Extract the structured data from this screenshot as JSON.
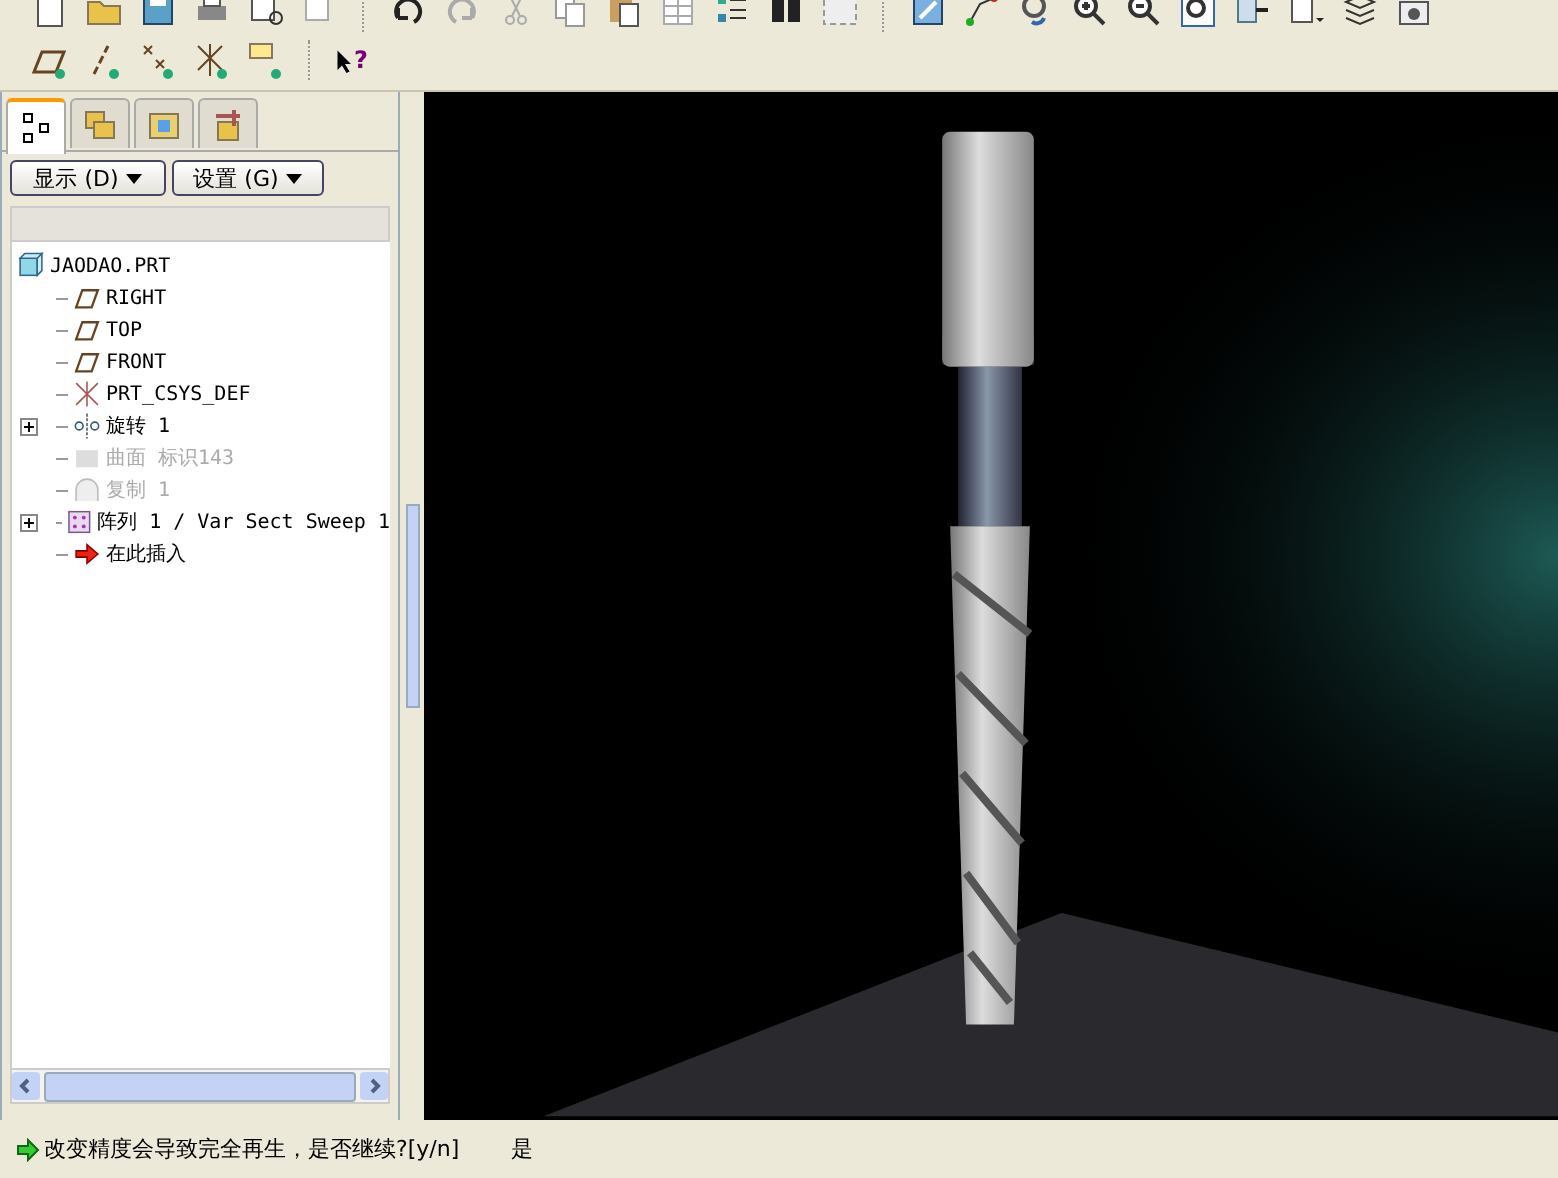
{
  "toolbar": {
    "help_mark": "?"
  },
  "navigator": {
    "tabs": [
      {
        "kind": "tree",
        "selected": true
      },
      {
        "kind": "layers",
        "selected": false
      },
      {
        "kind": "folder",
        "selected": false
      },
      {
        "kind": "tools",
        "selected": false
      }
    ],
    "buttons": [
      "显示 (D)",
      "设置 (G)"
    ],
    "tree": {
      "root": {
        "label": "JAODAO.PRT",
        "kind": "part"
      },
      "items": [
        {
          "label": "RIGHT",
          "kind": "plane",
          "collapsed": false,
          "disabled": false
        },
        {
          "label": "TOP",
          "kind": "plane",
          "collapsed": false,
          "disabled": false
        },
        {
          "label": "FRONT",
          "kind": "plane",
          "collapsed": false,
          "disabled": false
        },
        {
          "label": "PRT_CSYS_DEF",
          "kind": "csys",
          "collapsed": false,
          "disabled": false
        },
        {
          "label": "旋转 1",
          "kind": "revolve",
          "collapsed": true,
          "disabled": false
        },
        {
          "label": "曲面 标识143",
          "kind": "surface",
          "collapsed": false,
          "disabled": true
        },
        {
          "label": "复制 1",
          "kind": "copy",
          "collapsed": false,
          "disabled": true
        },
        {
          "label": "阵列 1 / Var Sect Sweep 1",
          "kind": "pattern",
          "collapsed": true,
          "disabled": false
        },
        {
          "label": "在此插入",
          "kind": "insert",
          "collapsed": false,
          "disabled": false
        }
      ]
    }
  },
  "status_bar": {
    "message": "改变精度会导致完全再生，是否继续?[y/n]",
    "answer": "是"
  }
}
